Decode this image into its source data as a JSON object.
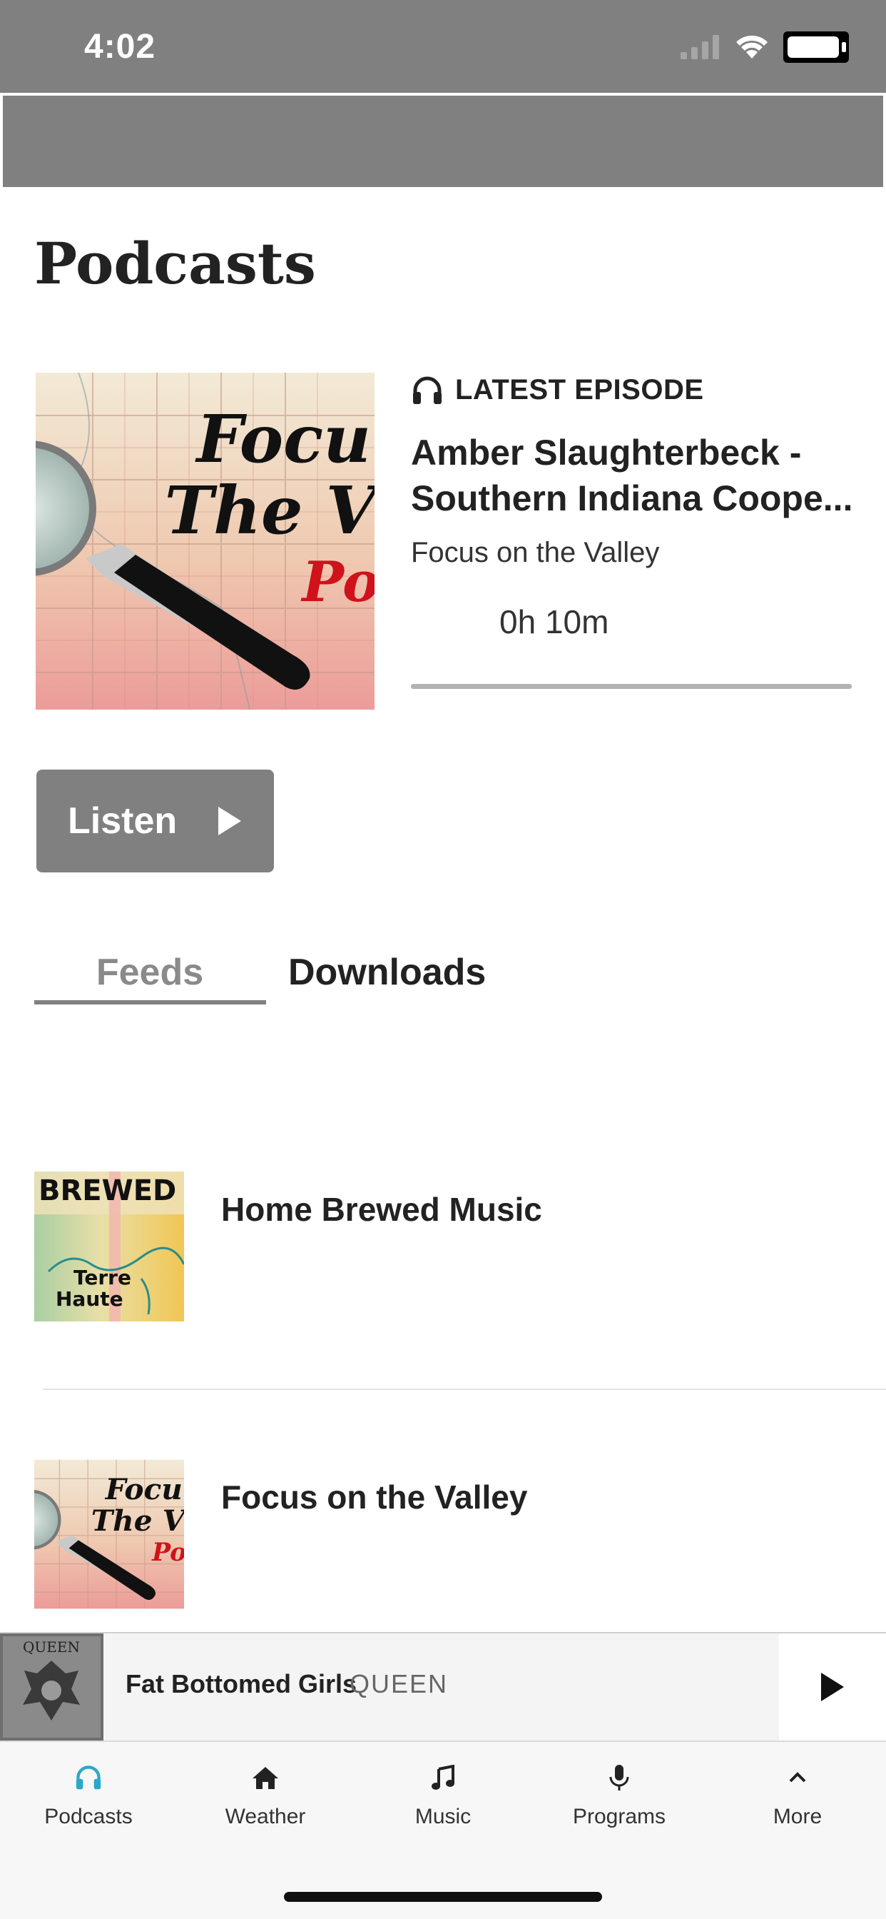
{
  "status_bar": {
    "time": "4:02"
  },
  "page": {
    "title": "Podcasts"
  },
  "latest": {
    "label": "LATEST EPISODE",
    "title_line1": "Amber Slaughterbeck -",
    "title_line2": "Southern Indiana Coope...",
    "show": "Focus on the Valley",
    "duration": "0h 10m",
    "art_text": {
      "line1": "Focu",
      "line2": "The V",
      "line3": "Po"
    },
    "listen_label": "Listen"
  },
  "tabs": {
    "feeds": "Feeds",
    "downloads": "Downloads"
  },
  "feeds": [
    {
      "title": "Home Brewed Music",
      "art_text": {
        "top": "BREWED",
        "city1": "Terre",
        "city2": "Haute"
      }
    },
    {
      "title": "Focus on the Valley",
      "art_text": {
        "line1": "Focu",
        "line2": "The V",
        "line3": "Po"
      }
    }
  ],
  "now_playing": {
    "title": "Fat Bottomed Girls",
    "artist": "QUEEN",
    "art_text": "QUEEN"
  },
  "tab_bar": [
    {
      "label": "Podcasts",
      "icon": "headphones-icon",
      "active": true
    },
    {
      "label": "Weather",
      "icon": "home-icon"
    },
    {
      "label": "Music",
      "icon": "music-note-icon"
    },
    {
      "label": "Programs",
      "icon": "microphone-icon"
    },
    {
      "label": "More",
      "icon": "chevron-up-icon"
    }
  ],
  "colors": {
    "accent": "#2aa8c9",
    "header_gray": "#808080",
    "text": "#222222"
  }
}
